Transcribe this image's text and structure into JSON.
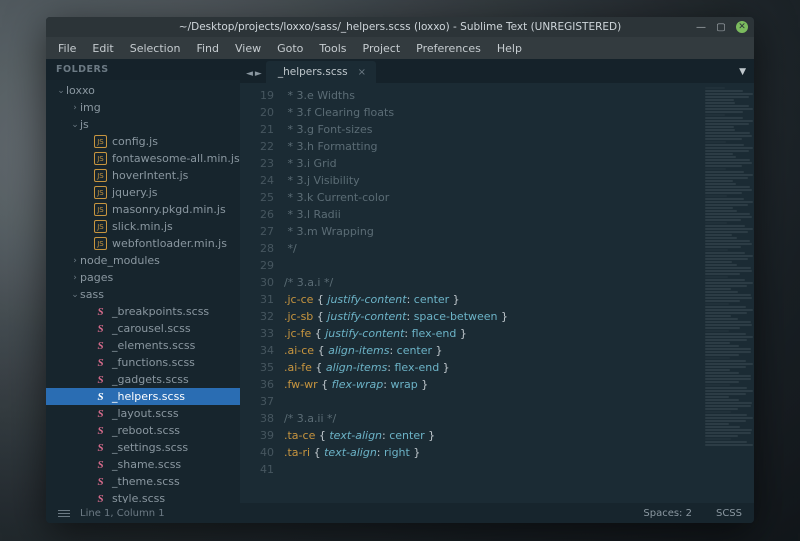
{
  "window": {
    "title": "~/Desktop/projects/loxxo/sass/_helpers.scss (loxxo) - Sublime Text (UNREGISTERED)"
  },
  "menu": [
    "File",
    "Edit",
    "Selection",
    "Find",
    "View",
    "Goto",
    "Tools",
    "Project",
    "Preferences",
    "Help"
  ],
  "sidebar": {
    "header": "FOLDERS",
    "tree": [
      {
        "depth": 0,
        "kind": "folder",
        "open": true,
        "label": "loxxo"
      },
      {
        "depth": 1,
        "kind": "folder",
        "open": false,
        "label": "img"
      },
      {
        "depth": 1,
        "kind": "folder",
        "open": true,
        "label": "js"
      },
      {
        "depth": 2,
        "kind": "js",
        "label": "config.js"
      },
      {
        "depth": 2,
        "kind": "js",
        "label": "fontawesome-all.min.js"
      },
      {
        "depth": 2,
        "kind": "js",
        "label": "hoverIntent.js"
      },
      {
        "depth": 2,
        "kind": "js",
        "label": "jquery.js"
      },
      {
        "depth": 2,
        "kind": "js",
        "label": "masonry.pkgd.min.js"
      },
      {
        "depth": 2,
        "kind": "js",
        "label": "slick.min.js"
      },
      {
        "depth": 2,
        "kind": "js",
        "label": "webfontloader.min.js"
      },
      {
        "depth": 1,
        "kind": "folder",
        "open": false,
        "label": "node_modules"
      },
      {
        "depth": 1,
        "kind": "folder",
        "open": false,
        "label": "pages"
      },
      {
        "depth": 1,
        "kind": "folder",
        "open": true,
        "label": "sass"
      },
      {
        "depth": 2,
        "kind": "sass",
        "label": "_breakpoints.scss"
      },
      {
        "depth": 2,
        "kind": "sass",
        "label": "_carousel.scss"
      },
      {
        "depth": 2,
        "kind": "sass",
        "label": "_elements.scss"
      },
      {
        "depth": 2,
        "kind": "sass",
        "label": "_functions.scss"
      },
      {
        "depth": 2,
        "kind": "sass",
        "label": "_gadgets.scss"
      },
      {
        "depth": 2,
        "kind": "sass",
        "label": "_helpers.scss",
        "selected": true
      },
      {
        "depth": 2,
        "kind": "sass",
        "label": "_layout.scss"
      },
      {
        "depth": 2,
        "kind": "sass",
        "label": "_reboot.scss"
      },
      {
        "depth": 2,
        "kind": "sass",
        "label": "_settings.scss"
      },
      {
        "depth": 2,
        "kind": "sass",
        "label": "_shame.scss"
      },
      {
        "depth": 2,
        "kind": "sass",
        "label": "_theme.scss"
      },
      {
        "depth": 2,
        "kind": "sass",
        "label": "style.scss"
      }
    ]
  },
  "tab": {
    "label": "_helpers.scss"
  },
  "code": {
    "first_line": 19,
    "lines": [
      [
        {
          "c": "c-cm",
          "t": " * 3.e Widths"
        }
      ],
      [
        {
          "c": "c-cm",
          "t": " * 3.f Clearing floats"
        }
      ],
      [
        {
          "c": "c-cm",
          "t": " * 3.g Font-sizes"
        }
      ],
      [
        {
          "c": "c-cm",
          "t": " * 3.h Formatting"
        }
      ],
      [
        {
          "c": "c-cm",
          "t": " * 3.i Grid"
        }
      ],
      [
        {
          "c": "c-cm",
          "t": " * 3.j Visibility"
        }
      ],
      [
        {
          "c": "c-cm",
          "t": " * 3.k Current-color"
        }
      ],
      [
        {
          "c": "c-cm",
          "t": " * 3.l Radii"
        }
      ],
      [
        {
          "c": "c-cm",
          "t": " * 3.m Wrapping"
        }
      ],
      [
        {
          "c": "c-cm",
          "t": " */"
        }
      ],
      [],
      [
        {
          "c": "c-cm",
          "t": "/* 3.a.i */"
        }
      ],
      [
        {
          "c": "c-sel",
          "t": ".jc-ce"
        },
        {
          "c": "c-pn",
          "t": " { "
        },
        {
          "c": "c-prop",
          "t": "justify-content"
        },
        {
          "c": "c-pn",
          "t": ": "
        },
        {
          "c": "c-val",
          "t": "center"
        },
        {
          "c": "c-pn",
          "t": " }"
        }
      ],
      [
        {
          "c": "c-sel",
          "t": ".jc-sb"
        },
        {
          "c": "c-pn",
          "t": " { "
        },
        {
          "c": "c-prop",
          "t": "justify-content"
        },
        {
          "c": "c-pn",
          "t": ": "
        },
        {
          "c": "c-val",
          "t": "space-between"
        },
        {
          "c": "c-pn",
          "t": " }"
        }
      ],
      [
        {
          "c": "c-sel",
          "t": ".jc-fe"
        },
        {
          "c": "c-pn",
          "t": " { "
        },
        {
          "c": "c-prop",
          "t": "justify-content"
        },
        {
          "c": "c-pn",
          "t": ": "
        },
        {
          "c": "c-val",
          "t": "flex-end"
        },
        {
          "c": "c-pn",
          "t": " }"
        }
      ],
      [
        {
          "c": "c-sel",
          "t": ".ai-ce"
        },
        {
          "c": "c-pn",
          "t": " { "
        },
        {
          "c": "c-prop",
          "t": "align-items"
        },
        {
          "c": "c-pn",
          "t": ": "
        },
        {
          "c": "c-val",
          "t": "center"
        },
        {
          "c": "c-pn",
          "t": " }"
        }
      ],
      [
        {
          "c": "c-sel",
          "t": ".ai-fe"
        },
        {
          "c": "c-pn",
          "t": " { "
        },
        {
          "c": "c-prop",
          "t": "align-items"
        },
        {
          "c": "c-pn",
          "t": ": "
        },
        {
          "c": "c-val",
          "t": "flex-end"
        },
        {
          "c": "c-pn",
          "t": " }"
        }
      ],
      [
        {
          "c": "c-sel",
          "t": ".fw-wr"
        },
        {
          "c": "c-pn",
          "t": " { "
        },
        {
          "c": "c-prop",
          "t": "flex-wrap"
        },
        {
          "c": "c-pn",
          "t": ": "
        },
        {
          "c": "c-val",
          "t": "wrap"
        },
        {
          "c": "c-pn",
          "t": " }"
        }
      ],
      [],
      [
        {
          "c": "c-cm",
          "t": "/* 3.a.ii */"
        }
      ],
      [
        {
          "c": "c-sel",
          "t": ".ta-ce"
        },
        {
          "c": "c-pn",
          "t": " { "
        },
        {
          "c": "c-prop",
          "t": "text-align"
        },
        {
          "c": "c-pn",
          "t": ": "
        },
        {
          "c": "c-val",
          "t": "center"
        },
        {
          "c": "c-pn",
          "t": " }"
        }
      ],
      [
        {
          "c": "c-sel",
          "t": ".ta-ri"
        },
        {
          "c": "c-pn",
          "t": " { "
        },
        {
          "c": "c-prop",
          "t": "text-align"
        },
        {
          "c": "c-pn",
          "t": ": "
        },
        {
          "c": "c-val",
          "t": "right"
        },
        {
          "c": "c-pn",
          "t": " }"
        }
      ],
      []
    ]
  },
  "status": {
    "left": "Line 1, Column 1",
    "spaces": "Spaces: 2",
    "syntax": "SCSS"
  },
  "colors": {
    "accent": "#2a6db3"
  }
}
